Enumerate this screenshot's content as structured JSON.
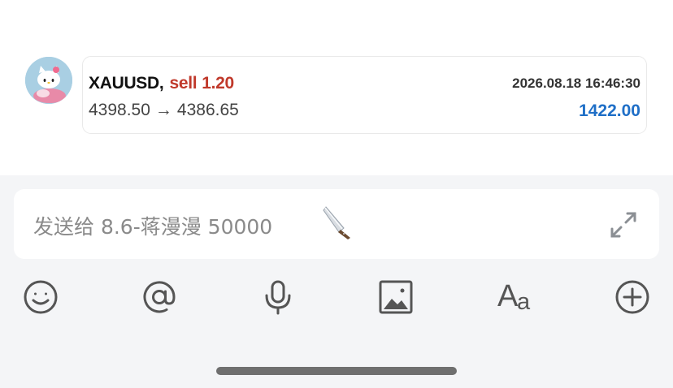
{
  "trade": {
    "symbol": "XAUUSD",
    "separator": ",",
    "side": "sell",
    "lots": "1.20",
    "open_price": "4398.50",
    "arrow": "→",
    "close_price": "4386.65",
    "datetime": "2026.08.18 16:46:30",
    "profit": "1422.00"
  },
  "composer": {
    "placeholder": "发送给 8.6-蒋漫漫 50000"
  },
  "icons": {
    "avatar": "hello-kitty-avatar",
    "knife": "knife-emoji",
    "expand": "expand-arrows-icon",
    "emoji": "emoji-smile-icon",
    "mention": "at-mention-icon",
    "voice": "microphone-icon",
    "image": "image-icon",
    "font": "font-format-icon",
    "add": "plus-circle-icon"
  },
  "toolbar": {
    "font_big": "A",
    "font_small": "a"
  },
  "colors": {
    "sell": "#c0392b",
    "profit": "#1f6fc7",
    "toolbar_bg": "#f4f5f7"
  }
}
